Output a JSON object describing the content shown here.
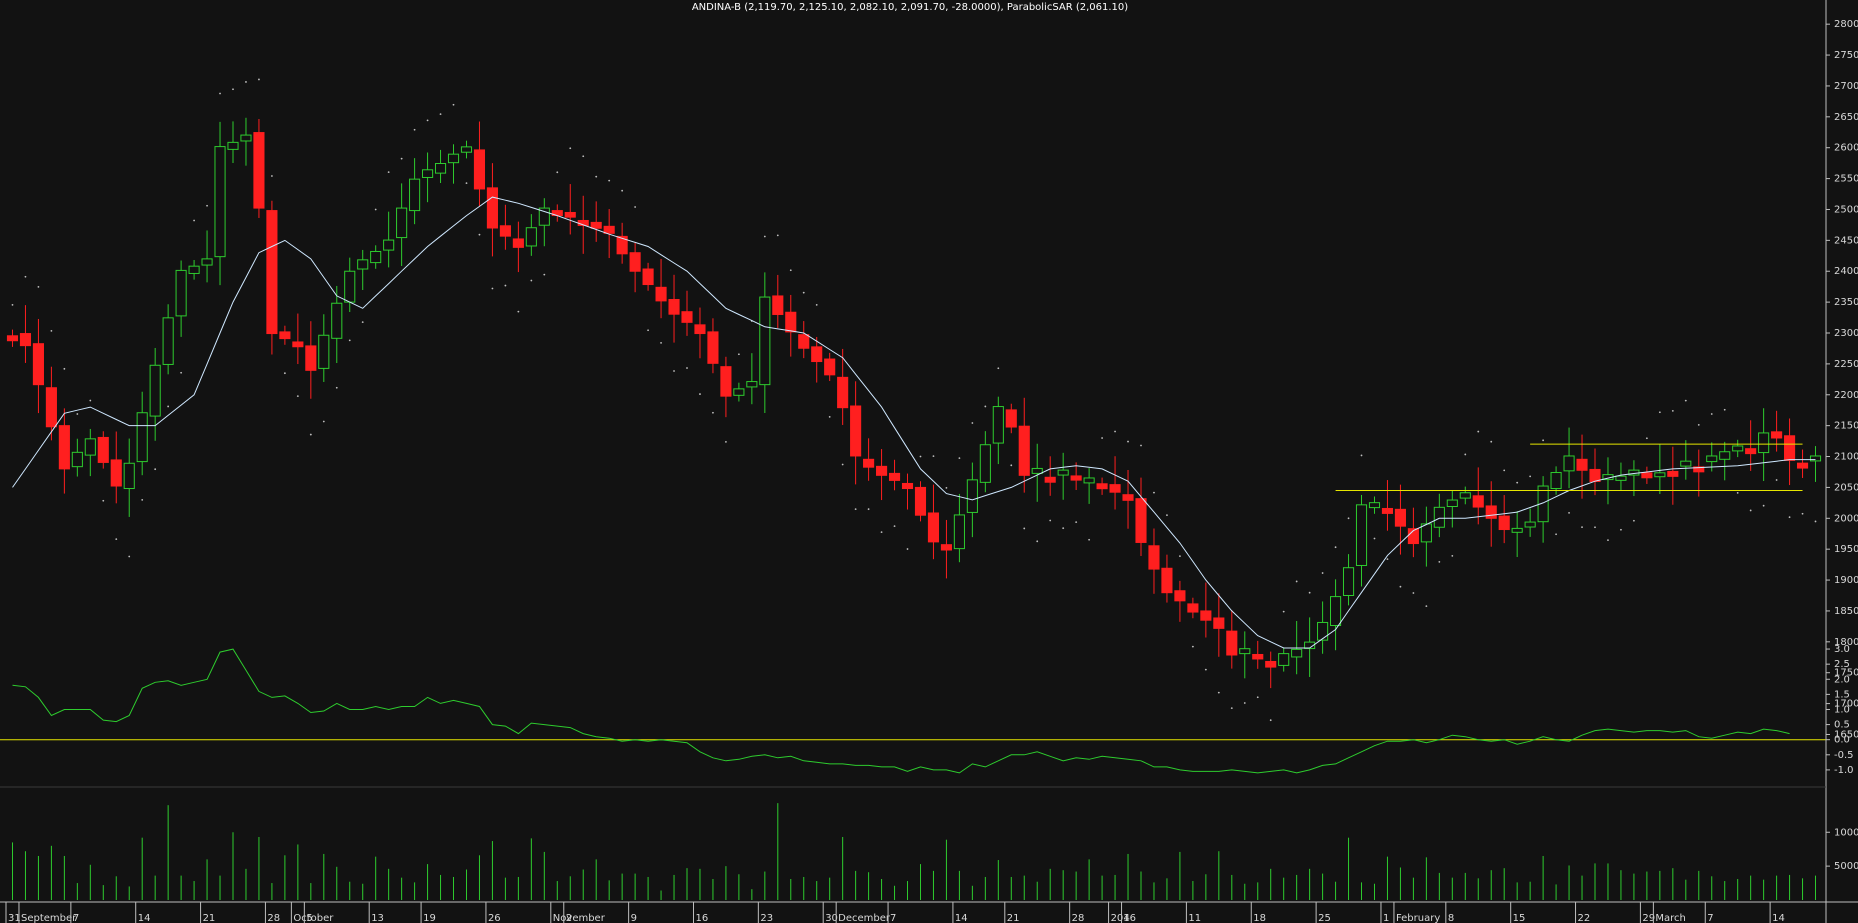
{
  "chart_data": {
    "type": "candlestick",
    "title": "ANDINA-B (2,119.70, 2,125.10, 2,082.10, 2,091.70, -28.0000), ParabolicSAR (2,061.10)",
    "colors": {
      "background": "#121212",
      "up": "#2ecc2e",
      "down": "#ff1f1f",
      "ma": "#cfe8ff",
      "indicator": "#2ecc2e",
      "zero_line": "#e6e600",
      "support_lines": "#e6e600",
      "volume": "#2ecc2e",
      "sar": "#bfbfbf",
      "grid": "#2b2b2b",
      "axis": "#bfbfbf"
    },
    "price_axis": {
      "ticks": [
        1650,
        1700,
        1750,
        1800,
        1850,
        1900,
        1950,
        2000,
        2050,
        2100,
        2150,
        2200,
        2250,
        2300,
        2350,
        2400,
        2450,
        2500,
        2550,
        2600,
        2650,
        2700,
        2750,
        2800
      ],
      "ylim": [
        1620,
        2810
      ]
    },
    "indicator_axis": {
      "ticks": [
        -1.0,
        -0.5,
        0.0,
        0.5,
        1.0,
        1.5,
        2.0,
        2.5,
        3.0
      ],
      "ylim": [
        -1.5,
        3.3
      ]
    },
    "volume_axis": {
      "ticks": [
        5000,
        10000
      ],
      "ylim": [
        0,
        15500
      ]
    },
    "x_labels": [
      {
        "i": 0,
        "label": "31"
      },
      {
        "i": 1,
        "label": "September"
      },
      {
        "i": 5,
        "label": "7"
      },
      {
        "i": 10,
        "label": "14"
      },
      {
        "i": 15,
        "label": "21"
      },
      {
        "i": 20,
        "label": "28"
      },
      {
        "i": 22,
        "label": "October"
      },
      {
        "i": 23,
        "label": "5"
      },
      {
        "i": 28,
        "label": "13"
      },
      {
        "i": 32,
        "label": "19"
      },
      {
        "i": 37,
        "label": "26"
      },
      {
        "i": 42,
        "label": "November"
      },
      {
        "i": 43,
        "label": "2"
      },
      {
        "i": 48,
        "label": "9"
      },
      {
        "i": 53,
        "label": "16"
      },
      {
        "i": 58,
        "label": "23"
      },
      {
        "i": 63,
        "label": "30"
      },
      {
        "i": 64,
        "label": "December"
      },
      {
        "i": 68,
        "label": "7"
      },
      {
        "i": 73,
        "label": "14"
      },
      {
        "i": 77,
        "label": "21"
      },
      {
        "i": 82,
        "label": "28"
      },
      {
        "i": 85,
        "label": "2016"
      },
      {
        "i": 86,
        "label": "4"
      },
      {
        "i": 91,
        "label": "11"
      },
      {
        "i": 96,
        "label": "18"
      },
      {
        "i": 101,
        "label": "25"
      },
      {
        "i": 106,
        "label": "1"
      },
      {
        "i": 107,
        "label": "February"
      },
      {
        "i": 111,
        "label": "8"
      },
      {
        "i": 116,
        "label": "15"
      },
      {
        "i": 121,
        "label": "22"
      },
      {
        "i": 126,
        "label": "29"
      },
      {
        "i": 127,
        "label": "March"
      },
      {
        "i": 131,
        "label": "7"
      },
      {
        "i": 136,
        "label": "14"
      }
    ],
    "horizontal_levels": [
      {
        "value": 2120,
        "from": 117,
        "to": 138
      },
      {
        "value": 2045,
        "from": 102,
        "to": 138
      }
    ],
    "price_keypoints": [
      [
        0,
        2300
      ],
      [
        1,
        2280
      ],
      [
        3,
        2150
      ],
      [
        4,
        2080
      ],
      [
        6,
        2130
      ],
      [
        8,
        2050
      ],
      [
        9,
        2090
      ],
      [
        11,
        2250
      ],
      [
        13,
        2400
      ],
      [
        15,
        2420
      ],
      [
        16,
        2600
      ],
      [
        18,
        2620
      ],
      [
        19,
        2500
      ],
      [
        20,
        2300
      ],
      [
        22,
        2280
      ],
      [
        23,
        2240
      ],
      [
        25,
        2350
      ],
      [
        26,
        2400
      ],
      [
        29,
        2450
      ],
      [
        31,
        2550
      ],
      [
        34,
        2590
      ],
      [
        35,
        2600
      ],
      [
        37,
        2470
      ],
      [
        39,
        2440
      ],
      [
        41,
        2500
      ],
      [
        44,
        2480
      ],
      [
        46,
        2460
      ],
      [
        48,
        2400
      ],
      [
        51,
        2330
      ],
      [
        53,
        2300
      ],
      [
        55,
        2200
      ],
      [
        57,
        2220
      ],
      [
        58,
        2360
      ],
      [
        60,
        2300
      ],
      [
        63,
        2230
      ],
      [
        64,
        2180
      ],
      [
        65,
        2100
      ],
      [
        67,
        2070
      ],
      [
        69,
        2050
      ],
      [
        71,
        1960
      ],
      [
        72,
        1950
      ],
      [
        74,
        2060
      ],
      [
        76,
        2180
      ],
      [
        77,
        2150
      ],
      [
        78,
        2070
      ],
      [
        80,
        2070
      ],
      [
        82,
        2060
      ],
      [
        84,
        2050
      ],
      [
        86,
        2030
      ],
      [
        87,
        1960
      ],
      [
        89,
        1880
      ],
      [
        91,
        1850
      ],
      [
        93,
        1820
      ],
      [
        94,
        1780
      ],
      [
        96,
        1770
      ],
      [
        97,
        1760
      ],
      [
        98,
        1780
      ],
      [
        100,
        1800
      ],
      [
        101,
        1830
      ],
      [
        103,
        1920
      ],
      [
        104,
        2020
      ],
      [
        106,
        2010
      ],
      [
        108,
        1960
      ],
      [
        110,
        2020
      ],
      [
        112,
        2040
      ],
      [
        114,
        2000
      ],
      [
        115,
        1980
      ],
      [
        117,
        1990
      ],
      [
        118,
        2050
      ],
      [
        120,
        2100
      ],
      [
        122,
        2060
      ],
      [
        124,
        2070
      ],
      [
        126,
        2070
      ],
      [
        128,
        2080
      ],
      [
        130,
        2090
      ],
      [
        132,
        2110
      ],
      [
        134,
        2110
      ],
      [
        135,
        2140
      ],
      [
        136,
        2130
      ],
      [
        137,
        2092
      ]
    ],
    "ma_keypoints": [
      [
        0,
        2050
      ],
      [
        4,
        2170
      ],
      [
        6,
        2180
      ],
      [
        9,
        2150
      ],
      [
        11,
        2150
      ],
      [
        14,
        2200
      ],
      [
        17,
        2350
      ],
      [
        19,
        2430
      ],
      [
        21,
        2450
      ],
      [
        23,
        2420
      ],
      [
        25,
        2360
      ],
      [
        27,
        2340
      ],
      [
        29,
        2380
      ],
      [
        32,
        2440
      ],
      [
        35,
        2490
      ],
      [
        37,
        2520
      ],
      [
        39,
        2510
      ],
      [
        42,
        2490
      ],
      [
        46,
        2460
      ],
      [
        49,
        2440
      ],
      [
        52,
        2400
      ],
      [
        55,
        2340
      ],
      [
        58,
        2310
      ],
      [
        61,
        2300
      ],
      [
        64,
        2260
      ],
      [
        67,
        2180
      ],
      [
        70,
        2080
      ],
      [
        72,
        2040
      ],
      [
        74,
        2030
      ],
      [
        77,
        2050
      ],
      [
        80,
        2080
      ],
      [
        82,
        2085
      ],
      [
        84,
        2080
      ],
      [
        86,
        2060
      ],
      [
        88,
        2010
      ],
      [
        90,
        1960
      ],
      [
        92,
        1900
      ],
      [
        94,
        1850
      ],
      [
        96,
        1810
      ],
      [
        98,
        1790
      ],
      [
        100,
        1790
      ],
      [
        102,
        1820
      ],
      [
        104,
        1880
      ],
      [
        106,
        1940
      ],
      [
        108,
        1980
      ],
      [
        110,
        2000
      ],
      [
        112,
        2000
      ],
      [
        114,
        2005
      ],
      [
        116,
        2010
      ],
      [
        118,
        2025
      ],
      [
        120,
        2045
      ],
      [
        122,
        2060
      ],
      [
        124,
        2070
      ],
      [
        126,
        2075
      ],
      [
        128,
        2080
      ],
      [
        130,
        2082
      ],
      [
        133,
        2085
      ],
      [
        135,
        2090
      ],
      [
        137,
        2095
      ]
    ],
    "indicator_keypoints": [
      [
        0,
        1.8
      ],
      [
        1,
        1.75
      ],
      [
        2,
        1.4
      ],
      [
        3,
        0.8
      ],
      [
        4,
        1.0
      ],
      [
        5,
        1.0
      ],
      [
        6,
        1.0
      ],
      [
        7,
        0.65
      ],
      [
        8,
        0.6
      ],
      [
        9,
        0.8
      ],
      [
        10,
        1.7
      ],
      [
        11,
        1.9
      ],
      [
        12,
        1.95
      ],
      [
        13,
        1.8
      ],
      [
        14,
        1.9
      ],
      [
        15,
        2.0
      ],
      [
        16,
        2.9
      ],
      [
        17,
        3.0
      ],
      [
        18,
        2.3
      ],
      [
        19,
        1.6
      ],
      [
        20,
        1.4
      ],
      [
        21,
        1.45
      ],
      [
        22,
        1.2
      ],
      [
        23,
        0.9
      ],
      [
        24,
        0.95
      ],
      [
        25,
        1.2
      ],
      [
        26,
        1.0
      ],
      [
        27,
        1.0
      ],
      [
        28,
        1.1
      ],
      [
        29,
        1.0
      ],
      [
        30,
        1.1
      ],
      [
        31,
        1.1
      ],
      [
        32,
        1.4
      ],
      [
        33,
        1.2
      ],
      [
        34,
        1.3
      ],
      [
        35,
        1.2
      ],
      [
        36,
        1.1
      ],
      [
        37,
        0.5
      ],
      [
        38,
        0.45
      ],
      [
        39,
        0.2
      ],
      [
        40,
        0.55
      ],
      [
        41,
        0.5
      ],
      [
        42,
        0.45
      ],
      [
        43,
        0.4
      ],
      [
        44,
        0.2
      ],
      [
        45,
        0.1
      ],
      [
        46,
        0.05
      ],
      [
        47,
        -0.05
      ],
      [
        48,
        0.0
      ],
      [
        49,
        -0.05
      ],
      [
        50,
        0.0
      ],
      [
        51,
        -0.05
      ],
      [
        52,
        -0.1
      ],
      [
        53,
        -0.4
      ],
      [
        54,
        -0.6
      ],
      [
        55,
        -0.7
      ],
      [
        56,
        -0.65
      ],
      [
        57,
        -0.55
      ],
      [
        58,
        -0.5
      ],
      [
        59,
        -0.6
      ],
      [
        60,
        -0.55
      ],
      [
        61,
        -0.7
      ],
      [
        62,
        -0.75
      ],
      [
        63,
        -0.8
      ],
      [
        64,
        -0.8
      ],
      [
        65,
        -0.85
      ],
      [
        66,
        -0.85
      ],
      [
        67,
        -0.9
      ],
      [
        68,
        -0.9
      ],
      [
        69,
        -1.05
      ],
      [
        70,
        -0.9
      ],
      [
        71,
        -1.0
      ],
      [
        72,
        -1.0
      ],
      [
        73,
        -1.1
      ],
      [
        74,
        -0.8
      ],
      [
        75,
        -0.9
      ],
      [
        76,
        -0.7
      ],
      [
        77,
        -0.5
      ],
      [
        78,
        -0.5
      ],
      [
        79,
        -0.4
      ],
      [
        80,
        -0.55
      ],
      [
        81,
        -0.7
      ],
      [
        82,
        -0.6
      ],
      [
        83,
        -0.65
      ],
      [
        84,
        -0.55
      ],
      [
        85,
        -0.6
      ],
      [
        86,
        -0.65
      ],
      [
        87,
        -0.7
      ],
      [
        88,
        -0.9
      ],
      [
        89,
        -0.9
      ],
      [
        90,
        -1.0
      ],
      [
        91,
        -1.05
      ],
      [
        92,
        -1.05
      ],
      [
        93,
        -1.05
      ],
      [
        94,
        -1.0
      ],
      [
        95,
        -1.05
      ],
      [
        96,
        -1.1
      ],
      [
        97,
        -1.05
      ],
      [
        98,
        -1.0
      ],
      [
        99,
        -1.1
      ],
      [
        100,
        -1.0
      ],
      [
        101,
        -0.85
      ],
      [
        102,
        -0.8
      ],
      [
        103,
        -0.6
      ],
      [
        104,
        -0.4
      ],
      [
        105,
        -0.2
      ],
      [
        106,
        -0.05
      ],
      [
        107,
        -0.05
      ],
      [
        108,
        0.0
      ],
      [
        109,
        -0.1
      ],
      [
        110,
        0.0
      ],
      [
        111,
        0.15
      ],
      [
        112,
        0.1
      ],
      [
        113,
        0.0
      ],
      [
        114,
        -0.05
      ],
      [
        115,
        0.0
      ],
      [
        116,
        -0.15
      ],
      [
        117,
        -0.05
      ],
      [
        118,
        0.1
      ],
      [
        119,
        0.0
      ],
      [
        120,
        -0.05
      ],
      [
        121,
        0.15
      ],
      [
        122,
        0.3
      ],
      [
        123,
        0.35
      ],
      [
        124,
        0.3
      ],
      [
        125,
        0.25
      ],
      [
        126,
        0.3
      ],
      [
        127,
        0.3
      ],
      [
        128,
        0.25
      ],
      [
        129,
        0.3
      ],
      [
        130,
        0.1
      ],
      [
        131,
        0.05
      ],
      [
        132,
        0.15
      ],
      [
        133,
        0.25
      ],
      [
        134,
        0.2
      ],
      [
        135,
        0.35
      ],
      [
        136,
        0.3
      ],
      [
        137,
        0.2
      ]
    ],
    "volume_values": [
      8500,
      7200,
      6500,
      8000,
      6500,
      2500,
      5200,
      2200,
      3500,
      2000,
      9200,
      3600,
      14000,
      3600,
      2800,
      6000,
      3600,
      10000,
      4600,
      9300,
      2500,
      6600,
      8200,
      2500,
      6800,
      4900,
      2700,
      2400,
      6400,
      4600,
      3300,
      2600,
      5300,
      3700,
      3400,
      4500,
      6600,
      8700,
      3300,
      3400,
      9100,
      7100,
      2800,
      3500,
      4500,
      6000,
      2900,
      3900,
      3900,
      3400,
      1400,
      3700,
      4700,
      4600,
      3100,
      5000,
      3800,
      1600,
      4200,
      14300,
      3100,
      3400,
      2800,
      3300,
      9300,
      4300,
      4100,
      3100,
      2100,
      2800,
      5300,
      4300,
      8900,
      4300,
      2100,
      3400,
      5900,
      3400,
      3600,
      2700,
      4600,
      4400,
      4200,
      6000,
      3600,
      3700,
      6800,
      4200,
      2600,
      3200,
      7100,
      2800,
      3800,
      7200,
      3700,
      2400,
      2600,
      4600,
      3300,
      3700,
      4600,
      3900,
      2700,
      9200,
      2600,
      2400,
      6400,
      4800,
      3300,
      6300,
      4000,
      3300,
      4000,
      3200,
      4400,
      4700,
      2600,
      2700,
      6500,
      2300,
      5100,
      3600,
      5400,
      5400,
      4400,
      3900,
      4200,
      4300,
      4700,
      3000,
      4300,
      3500,
      2800,
      3100,
      3600,
      3000,
      3600,
      3700,
      3200,
      3600
    ]
  }
}
